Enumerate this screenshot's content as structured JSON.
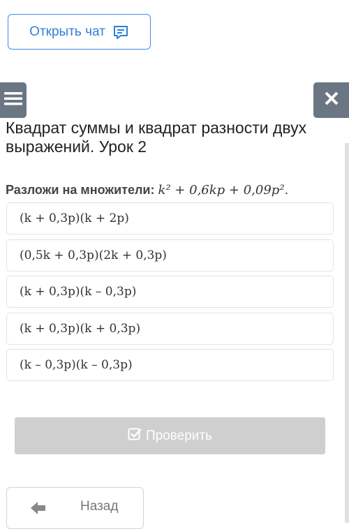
{
  "header": {
    "open_chat_label": "Открыть чат",
    "chat_icon": "chat-icon",
    "menu_icon": "hamburger-menu-icon",
    "close_icon": "close-icon"
  },
  "lesson": {
    "title": "Квадрат суммы и квадрат разности двух выражений. Урок 2"
  },
  "question": {
    "label": "Разложи на множители:",
    "expression": "k² + 0,6kp + 0,09p²."
  },
  "options": [
    "(k + 0,3p)(k + 2p)",
    "(0,5k + 0,3p)(2k + 0,3p)",
    "(k + 0,3p)(k – 0,3p)",
    "(k + 0,3p)(k + 0,3p)",
    "(k – 0,3p)(k – 0,3p)"
  ],
  "actions": {
    "check_label": "Проверить",
    "check_icon": "checkbox-check-icon",
    "back_label": "Назад",
    "back_icon": "arrow-left-icon"
  },
  "colors": {
    "accent": "#2f7fd6",
    "header_buttons": "#6b7684",
    "disabled_button": "#cfcfcf"
  }
}
